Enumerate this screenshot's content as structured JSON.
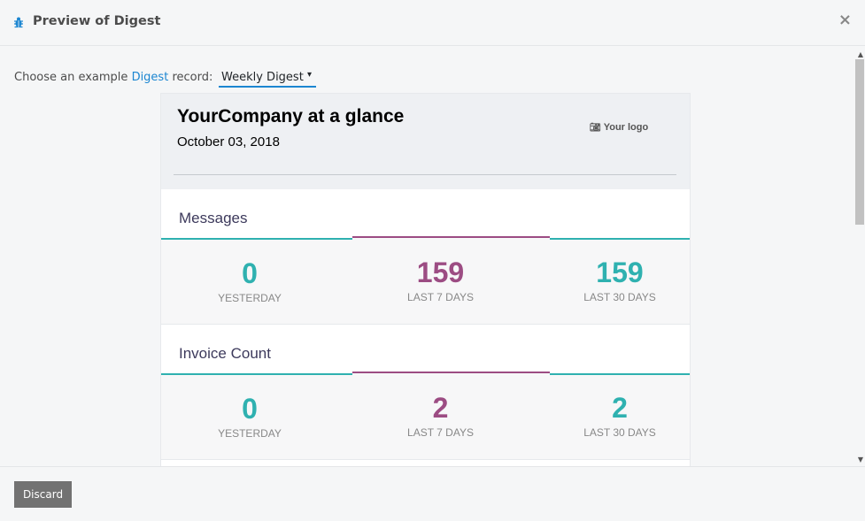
{
  "modal": {
    "title": "Preview of Digest",
    "close_label": "×",
    "title_icon": "bug-icon"
  },
  "chooser": {
    "prefix": "Choose an example",
    "link": "Digest",
    "suffix": "record:",
    "selected": "Weekly Digest",
    "caret": "▾"
  },
  "digest": {
    "company_heading": "YourCompany at a glance",
    "date": "October 03, 2018",
    "logo_text": "Your logo",
    "logo_icon": "camera-icon",
    "kpis": [
      {
        "title": "Messages",
        "values": [
          {
            "value": "0",
            "label": "YESTERDAY",
            "color": "#2fb1b0"
          },
          {
            "value": "159",
            "label": "LAST 7 DAYS",
            "color": "#9c4c83"
          },
          {
            "value": "159",
            "label": "LAST 30 DAYS",
            "color": "#2fb1b0"
          }
        ]
      },
      {
        "title": "Invoice Count",
        "values": [
          {
            "value": "0",
            "label": "YESTERDAY",
            "color": "#2fb1b0"
          },
          {
            "value": "2",
            "label": "LAST 7 DAYS",
            "color": "#9c4c83"
          },
          {
            "value": "2",
            "label": "LAST 30 DAYS",
            "color": "#2fb1b0"
          }
        ]
      }
    ]
  },
  "footer": {
    "discard_label": "Discard"
  },
  "colors": {
    "accent": "#1c86d1",
    "teal": "#2fb1b0",
    "plum": "#9c4c83"
  }
}
